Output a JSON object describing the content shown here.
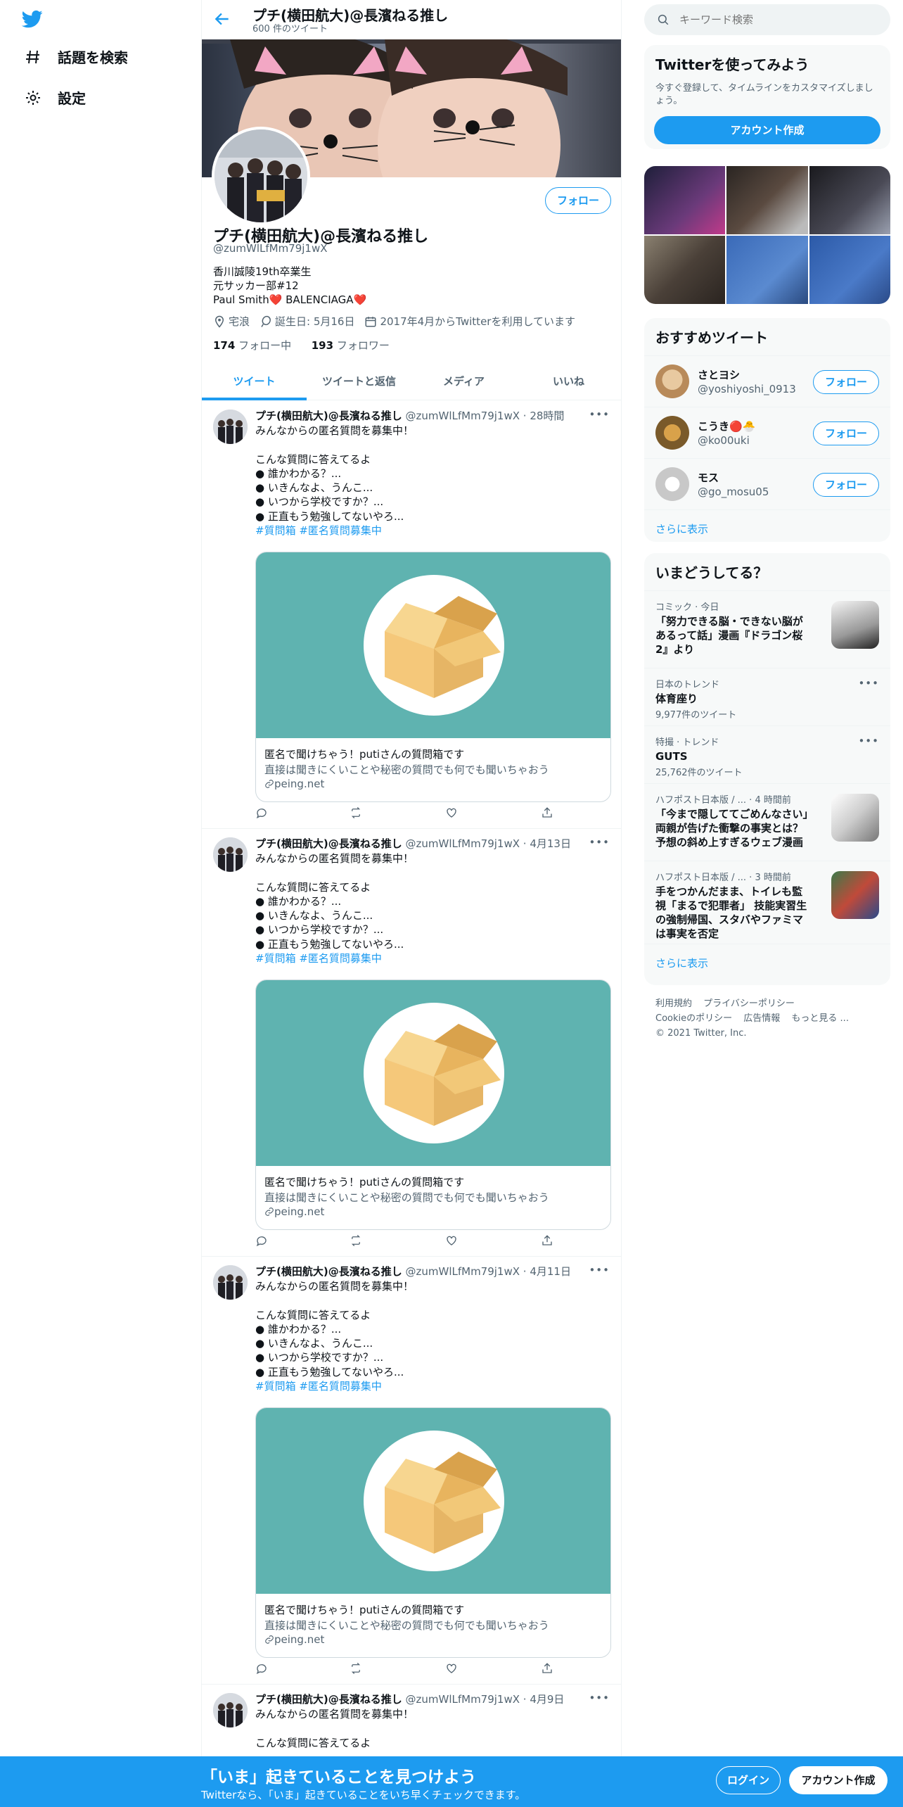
{
  "nav": {
    "explore_label": "話題を検索",
    "settings_label": "設定"
  },
  "header": {
    "name": "プチ(横田航大)@長濱ねる推し",
    "tweet_count": "600 件のツイート"
  },
  "profile": {
    "name": "プチ(横田航大)@長濱ねる推し",
    "handle": "@zumWlLfMm79j1wX",
    "bio_line1": "香川誠陵19th卒業生",
    "bio_line2": "元サッカー部#12",
    "bio_line3": "Paul Smith❤️ BALENCIAGA❤️",
    "location": "宅浪",
    "birthday": "誕生日: 5月16日",
    "joined": "2017年4月からTwitterを利用しています",
    "following_count": "174",
    "following_label": "フォロー中",
    "followers_count": "193",
    "followers_label": "フォロワー",
    "follow_label": "フォロー"
  },
  "tabs": [
    "ツイート",
    "ツイートと返信",
    "メディア",
    "いいね"
  ],
  "tweets": [
    {
      "name": "プチ(横田航大)@長濱ねる推し",
      "meta": "@zumWlLfMm79j1wX · 28時間",
      "text": "みんなからの匿名質問を募集中！\n\nこんな質問に答えてるよ\n● 誰かわかる？...\n● いきんなよ、うんこ...\n● いつから学校ですか？...\n● 正直もう勉強してないやろ...",
      "hashtags": "#質問箱 #匿名質問募集中",
      "card_title": "匿名で聞けちゃう！putiさんの質問箱です",
      "card_desc": "直接は聞きにくいことや秘密の質問でも何でも聞いちゃおう",
      "card_domain": "peing.net"
    },
    {
      "name": "プチ(横田航大)@長濱ねる推し",
      "meta": "@zumWlLfMm79j1wX · 4月13日",
      "text": "みんなからの匿名質問を募集中！\n\nこんな質問に答えてるよ\n● 誰かわかる？...\n● いきんなよ、うんこ...\n● いつから学校ですか？...\n● 正直もう勉強してないやろ...",
      "hashtags": "#質問箱 #匿名質問募集中",
      "card_title": "匿名で聞けちゃう！putiさんの質問箱です",
      "card_desc": "直接は聞きにくいことや秘密の質問でも何でも聞いちゃおう",
      "card_domain": "peing.net"
    },
    {
      "name": "プチ(横田航大)@長濱ねる推し",
      "meta": "@zumWlLfMm79j1wX · 4月11日",
      "text": "みんなからの匿名質問を募集中！\n\nこんな質問に答えてるよ\n● 誰かわかる？...\n● いきんなよ、うんこ...\n● いつから学校ですか？...\n● 正直もう勉強してないやろ...",
      "hashtags": "#質問箱 #匿名質問募集中",
      "card_title": "匿名で聞けちゃう！putiさんの質問箱です",
      "card_desc": "直接は聞きにくいことや秘密の質問でも何でも聞いちゃおう",
      "card_domain": "peing.net"
    },
    {
      "name": "プチ(横田航大)@長濱ねる推し",
      "meta": "@zumWlLfMm79j1wX · 4月9日",
      "text": "みんなからの匿名質問を募集中！\n\nこんな質問に答えてるよ"
    }
  ],
  "search": {
    "placeholder": "キーワード検索"
  },
  "signup_panel": {
    "title": "Twitterを使ってみよう",
    "subtitle": "今すぐ登録して、タイムラインをカスタマイズしましょう。",
    "button": "アカウント作成"
  },
  "recommended": {
    "title": "おすすめツイート",
    "users": [
      {
        "name": "さとヨシ",
        "handle": "@yoshiyoshi_0913"
      },
      {
        "name": "こうき🔴🐣",
        "handle": "@ko00uki"
      },
      {
        "name": "モス",
        "handle": "@go_mosu05"
      }
    ],
    "follow_label": "フォロー",
    "show_more": "さらに表示"
  },
  "trends": {
    "title": "いまどうしてる？",
    "items": [
      {
        "meta": "コミック · 今日",
        "title": "「努力できる脳・できない脳があるって話」漫画『ドラゴン桜2』より"
      },
      {
        "meta": "日本のトレンド",
        "title": "体育座り",
        "count": "9,977件のツイート"
      },
      {
        "meta": "特撮 · トレンド",
        "title": "GUTS",
        "count": "25,762件のツイート"
      },
      {
        "meta": "ハフポスト日本版 / ... · 4 時間前",
        "title": "「今まで隠しててごめんなさい」両親が告げた衝撃の事実とは？予想の斜め上すぎるウェブ漫画"
      },
      {
        "meta": "ハフポスト日本版 / ... · 3 時間前",
        "title": "手をつかんだまま、トイレも監視「まるで犯罪者」 技能実習生の強制帰国、スタバやファミマは事実を否定"
      }
    ],
    "show_more": "さらに表示"
  },
  "footer": {
    "terms": "利用規約",
    "privacy": "プライバシーポリシー",
    "cookie": "Cookieのポリシー",
    "ads": "広告情報",
    "more": "もっと見る ...",
    "copyright": "© 2021 Twitter, Inc."
  },
  "bottombar": {
    "title": "「いま」起きていることを見つけよう",
    "subtitle": "Twitterなら、「いま」起きていることをいち早くチェックできます。",
    "login": "ログイン",
    "signup": "アカウント作成"
  },
  "colors": {
    "accent": "#1d9bf0",
    "card_bg": "#5fb3b0",
    "box": "#f5c87a"
  }
}
